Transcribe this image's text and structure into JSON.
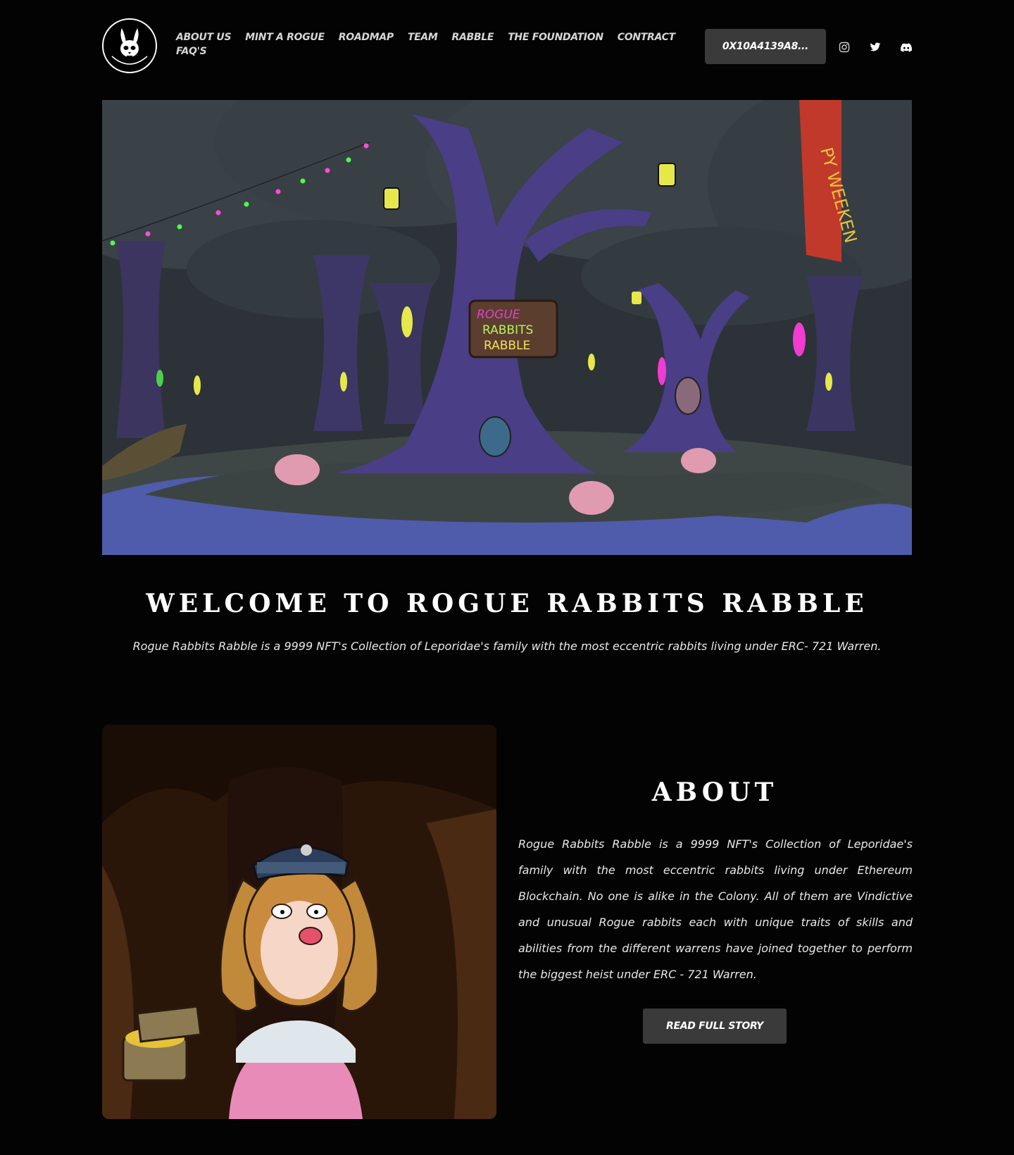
{
  "header": {
    "logo_alt": "Rogue Rabbits Rabble",
    "nav": [
      {
        "label": "ABOUT US"
      },
      {
        "label": "MINT A ROGUE"
      },
      {
        "label": "ROADMAP"
      },
      {
        "label": "TEAM"
      },
      {
        "label": "RABBLE"
      },
      {
        "label": "THE FOUNDATION"
      },
      {
        "label": "CONTRACT"
      },
      {
        "label": "FAQ'S"
      }
    ],
    "wallet_label": "0X10A4139A8...",
    "social": [
      "instagram-icon",
      "twitter-icon",
      "discord-icon"
    ]
  },
  "hero": {
    "sign_lines": [
      "ROGUE",
      "RABBITS",
      "RABBLE"
    ],
    "banner_text": "PY WEEKEN"
  },
  "welcome": {
    "title": "WELCOME TO ROGUE RABBITS RABBLE",
    "subtitle": "Rogue Rabbits Rabble is a 9999 NFT's Collection of Leporidae's family with the most eccentric rabbits living under ERC- 721 Warren."
  },
  "about": {
    "title": "ABOUT",
    "text": "Rogue Rabbits Rabble is a 9999 NFT's Collection of Leporidae's family with the most eccentric rabbits living under Ethereum Blockchain. No one is alike in the Colony. All of them are Vindictive and unusual Rogue rabbits each with unique traits of skills and abilities from the different warrens have joined together to perform the biggest heist under ERC - 721 Warren.",
    "button_label": "READ FULL STORY"
  },
  "colors": {
    "background": "#030303",
    "button": "#3a3a3a",
    "text": "#ffffff"
  }
}
